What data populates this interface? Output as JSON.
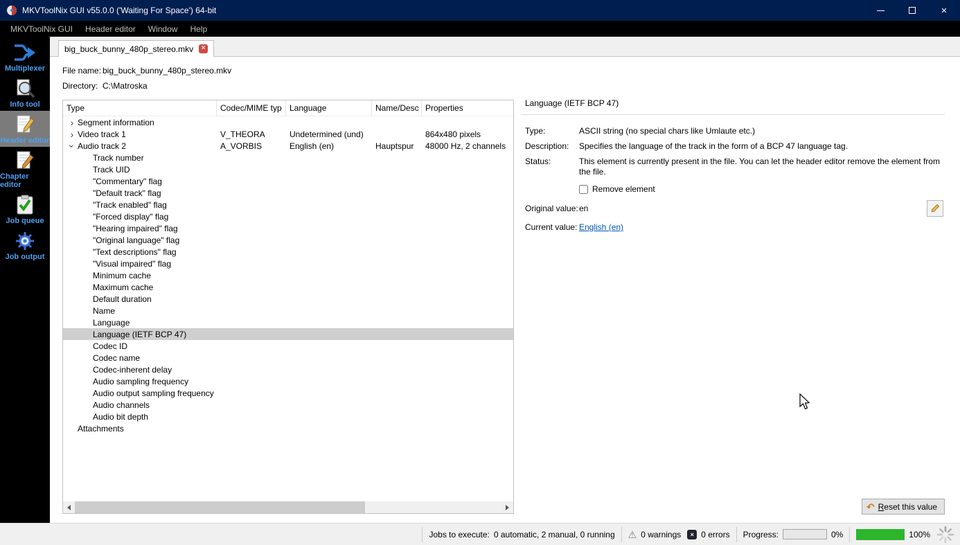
{
  "window": {
    "title": "MKVToolNix GUI v55.0.0 ('Waiting For Space') 64-bit"
  },
  "menu": {
    "items": [
      "MKVToolNix GUI",
      "Header editor",
      "Window",
      "Help"
    ]
  },
  "sidebar": {
    "items": [
      {
        "label": "Multiplexer",
        "icon": "multiplexer-icon",
        "selected": false
      },
      {
        "label": "Info tool",
        "icon": "info-tool-icon",
        "selected": false
      },
      {
        "label": "Header editor",
        "icon": "header-editor-icon",
        "selected": true
      },
      {
        "label": "Chapter editor",
        "icon": "chapter-editor-icon",
        "selected": false
      },
      {
        "label": "Job queue",
        "icon": "job-queue-icon",
        "selected": false
      },
      {
        "label": "Job output",
        "icon": "job-output-icon",
        "selected": false
      }
    ]
  },
  "tab": {
    "label": "big_buck_bunny_480p_stereo.mkv",
    "close_icon": "close-icon"
  },
  "file_info": {
    "file_name_label": "File name:",
    "file_name": "big_buck_bunny_480p_stereo.mkv",
    "directory_label": "Directory:",
    "directory": "C:\\Matroska"
  },
  "tree": {
    "columns": [
      "Type",
      "Codec/MIME typ",
      "Language",
      "Name/Desc",
      "Properties"
    ],
    "rows": [
      {
        "type": "Segment information",
        "level": 0,
        "state": "collapsed"
      },
      {
        "type": "Video track 1",
        "level": 0,
        "state": "collapsed",
        "codec": "V_THEORA",
        "language": "Undetermined (und)",
        "properties": "864x480 pixels"
      },
      {
        "type": "Audio track 2",
        "level": 0,
        "state": "expanded",
        "codec": "A_VORBIS",
        "language": "English (en)",
        "name": "Hauptspur",
        "properties": "48000 Hz, 2 channels"
      },
      {
        "type": "Track number",
        "level": 1,
        "state": "none"
      },
      {
        "type": "Track UID",
        "level": 1,
        "state": "none"
      },
      {
        "type": "\"Commentary\" flag",
        "level": 1,
        "state": "none"
      },
      {
        "type": "\"Default track\" flag",
        "level": 1,
        "state": "none"
      },
      {
        "type": "\"Track enabled\" flag",
        "level": 1,
        "state": "none"
      },
      {
        "type": "\"Forced display\" flag",
        "level": 1,
        "state": "none"
      },
      {
        "type": "\"Hearing impaired\" flag",
        "level": 1,
        "state": "none"
      },
      {
        "type": "\"Original language\" flag",
        "level": 1,
        "state": "none"
      },
      {
        "type": "\"Text descriptions\" flag",
        "level": 1,
        "state": "none"
      },
      {
        "type": "\"Visual impaired\" flag",
        "level": 1,
        "state": "none"
      },
      {
        "type": "Minimum cache",
        "level": 1,
        "state": "none"
      },
      {
        "type": "Maximum cache",
        "level": 1,
        "state": "none"
      },
      {
        "type": "Default duration",
        "level": 1,
        "state": "none"
      },
      {
        "type": "Name",
        "level": 1,
        "state": "none"
      },
      {
        "type": "Language",
        "level": 1,
        "state": "none"
      },
      {
        "type": "Language (IETF BCP 47)",
        "level": 1,
        "state": "none",
        "selected": true
      },
      {
        "type": "Codec ID",
        "level": 1,
        "state": "none"
      },
      {
        "type": "Codec name",
        "level": 1,
        "state": "none"
      },
      {
        "type": "Codec-inherent delay",
        "level": 1,
        "state": "none"
      },
      {
        "type": "Audio sampling frequency",
        "level": 1,
        "state": "none"
      },
      {
        "type": "Audio output sampling frequency",
        "level": 1,
        "state": "none"
      },
      {
        "type": "Audio channels",
        "level": 1,
        "state": "none"
      },
      {
        "type": "Audio bit depth",
        "level": 1,
        "state": "none"
      },
      {
        "type": "Attachments",
        "level": 0,
        "state": "none"
      }
    ]
  },
  "details": {
    "title": "Language (IETF BCP 47)",
    "type_label": "Type:",
    "type_value": "ASCII string (no special chars like Umlaute etc.)",
    "description_label": "Description:",
    "description_value": "Specifies the language of the track in the form of a BCP 47 language tag.",
    "status_label": "Status:",
    "status_value": "This element is currently present in the file. You can let the header editor remove the element from the file.",
    "remove_checkbox_label": "Remove element",
    "original_value_label": "Original value:",
    "original_value": "en",
    "current_value_label": "Current value:",
    "current_value": "English (en)",
    "edit_icon": "pencil-icon",
    "reset_button_label": "Reset this value",
    "reset_icon": "undo-icon"
  },
  "statusbar": {
    "jobs_label": "Jobs to execute:",
    "jobs_value": "0 automatic, 2 manual, 0 running",
    "warnings_icon": "warning-icon",
    "warnings": "0 warnings",
    "errors_icon": "error-icon",
    "errors": "0 errors",
    "progress_label": "Progress:",
    "progress_current_pct": "0%",
    "progress_total_pct": "100%",
    "spinner_icon": "busy-spinner-icon"
  },
  "colors": {
    "titlebar_bg": "#001e50",
    "selected_row": "#cfcfcf",
    "sidebar_selected": "#7b7b7b",
    "sidebar_label": "#4f9ff0",
    "link": "#0056b3",
    "progress_fill": "#2db52d",
    "tab_close": "#cf4a41"
  }
}
